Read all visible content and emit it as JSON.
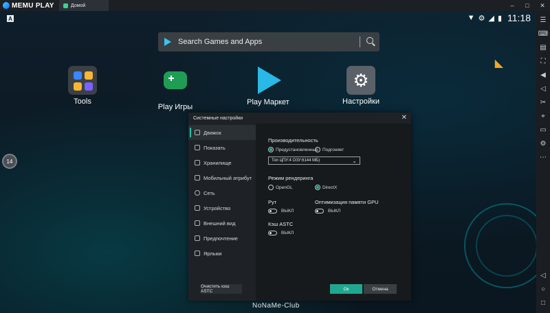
{
  "titlebar": {
    "app_name": "MEMU PLAY",
    "tab_label": "Домой"
  },
  "status": {
    "badge": "A",
    "time": "11:18"
  },
  "search": {
    "placeholder": "Search Games and Apps"
  },
  "apps": [
    {
      "label": "Tools"
    },
    {
      "label": "Play Игры"
    },
    {
      "label": "Play Маркет"
    },
    {
      "label": "Настройки"
    }
  ],
  "floating_badge": "14",
  "watermark": "NoNaMe-Club",
  "dialog": {
    "title": "Системные настройки",
    "nav": [
      {
        "label": "Движок",
        "icon": "engine-icon",
        "active": true
      },
      {
        "label": "Показать",
        "icon": "display-icon"
      },
      {
        "label": "Хранилище",
        "icon": "storage-icon"
      },
      {
        "label": "Мобильный атрибут",
        "icon": "tag-icon"
      },
      {
        "label": "Сеть",
        "icon": "globe-icon"
      },
      {
        "label": "Устройство",
        "icon": "phone-icon"
      },
      {
        "label": "Внешний вид",
        "icon": "appearance-icon"
      },
      {
        "label": "Предпочтение",
        "icon": "preference-icon"
      },
      {
        "label": "Ярлыки",
        "icon": "shortcut-icon"
      }
    ],
    "performance": {
      "title": "Производительность",
      "option_preset": "Предустановленные",
      "option_custom": "Подгоняет",
      "selected": "preset",
      "select_value": "Топ ЦПУ:4 ОЗУ:6144 МБ)"
    },
    "render": {
      "title": "Режим рендеринга",
      "option_opengl": "OpenGL",
      "option_directx": "DirectX",
      "selected": "directx"
    },
    "root": {
      "title": "Рут",
      "state": "ВЫКЛ"
    },
    "gpu_opt": {
      "title": "Оптимизация памяти GPU",
      "state": "ВЫКЛ"
    },
    "astc": {
      "title": "Кэш ASTC",
      "state": "ВЫКЛ"
    },
    "buttons": {
      "clear": "Очистить кэш ASTC",
      "ok": "Ок",
      "cancel": "Отмена"
    }
  },
  "colors": {
    "accent": "#22c0a6",
    "dialog_bg": "#1e2226",
    "panel_bg": "#171a1d"
  }
}
